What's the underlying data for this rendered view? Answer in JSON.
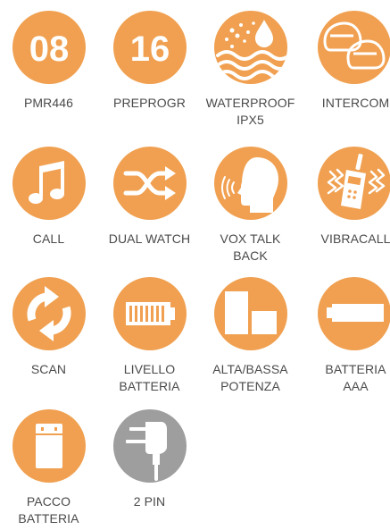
{
  "accent": "#F0A050",
  "neutral": "#9E9E9E",
  "items": [
    {
      "icon": "number-08-icon",
      "badge": "08",
      "lines": [
        "PMR446"
      ]
    },
    {
      "icon": "number-16-icon",
      "badge": "16",
      "lines": [
        "PREPROGR"
      ]
    },
    {
      "icon": "waterproof-icon",
      "lines": [
        "WATERPROOF",
        "IPX5"
      ]
    },
    {
      "icon": "intercom-helmets-icon",
      "lines": [
        "INTERCOM"
      ]
    },
    {
      "icon": "music-note-icon",
      "lines": [
        "CALL"
      ]
    },
    {
      "icon": "shuffle-arrows-icon",
      "lines": [
        "DUAL WATCH"
      ]
    },
    {
      "icon": "talking-head-icon",
      "lines": [
        "VOX TALK",
        "BACK"
      ]
    },
    {
      "icon": "vibrating-radio-icon",
      "lines": [
        "VIBRACALL"
      ]
    },
    {
      "icon": "scan-arrows-icon",
      "lines": [
        "SCAN"
      ]
    },
    {
      "icon": "battery-level-icon",
      "lines": [
        "LIVELLO",
        "BATTERIA"
      ]
    },
    {
      "icon": "power-levels-icon",
      "lines": [
        "ALTA/BASSA",
        "POTENZA"
      ]
    },
    {
      "icon": "aaa-battery-icon",
      "lines": [
        "BATTERIA",
        "AAA"
      ]
    },
    {
      "icon": "battery-pack-icon",
      "lines": [
        "PACCO",
        "BATTERIA"
      ]
    },
    {
      "icon": "two-pin-plug-icon",
      "lines": [
        "2 PIN"
      ]
    }
  ]
}
